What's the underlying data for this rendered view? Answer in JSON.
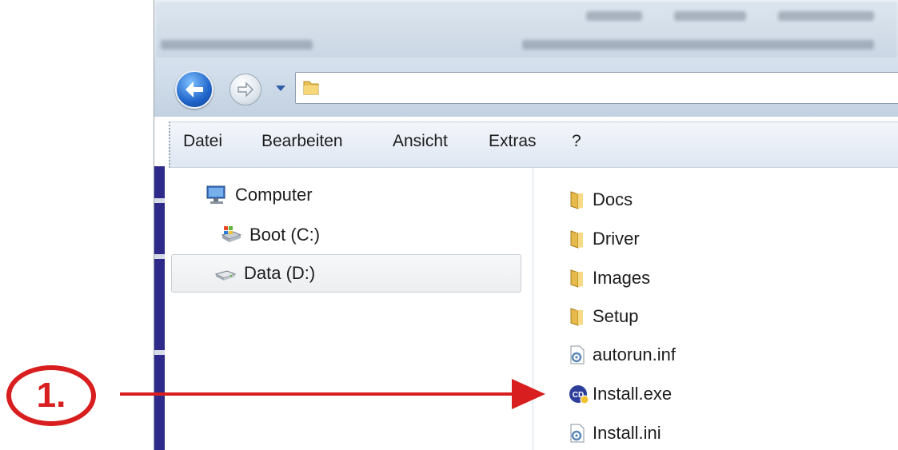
{
  "menu": {
    "items": [
      "Datei",
      "Bearbeiten",
      "Ansicht",
      "Extras",
      "?"
    ]
  },
  "navigation": {
    "items": [
      {
        "label": "Computer",
        "icon": "computer-icon"
      },
      {
        "label": "Boot (C:)",
        "icon": "system-drive-icon"
      },
      {
        "label": "Data (D:)",
        "icon": "drive-icon",
        "selected": true
      }
    ]
  },
  "files": [
    {
      "name": "Docs",
      "icon": "folder-icon"
    },
    {
      "name": "Driver",
      "icon": "folder-icon"
    },
    {
      "name": "Images",
      "icon": "folder-icon"
    },
    {
      "name": "Setup",
      "icon": "folder-icon"
    },
    {
      "name": "autorun.inf",
      "icon": "settings-file-icon"
    },
    {
      "name": "Install.exe",
      "icon": "installer-icon"
    },
    {
      "name": "Install.ini",
      "icon": "settings-file-icon"
    }
  ],
  "annotation": {
    "step_label": "1.",
    "color": "#d81e1e"
  },
  "colors": {
    "accent": "#2e2a8a",
    "nav_button": "#1f64c9",
    "menubar": "#dfe7f2"
  }
}
